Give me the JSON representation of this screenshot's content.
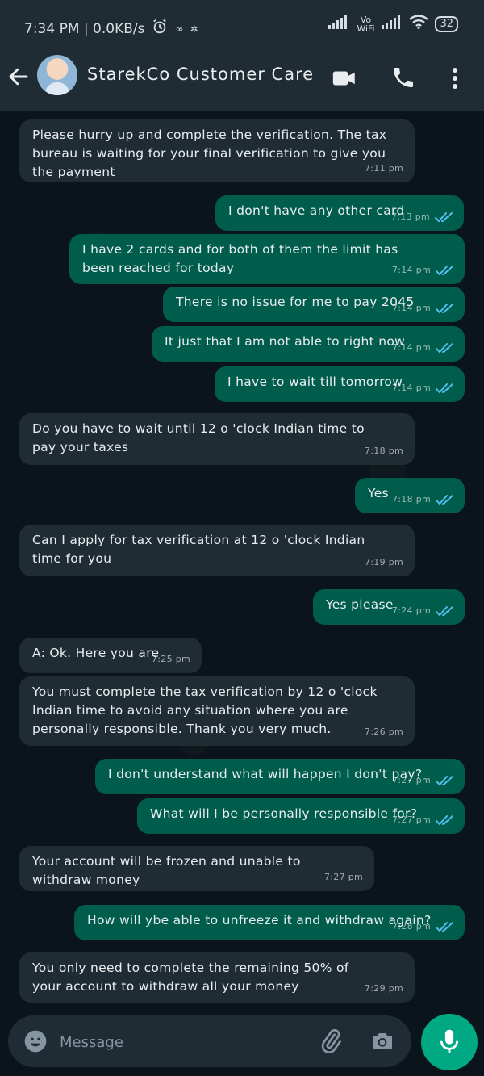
{
  "status_bar": {
    "left_text": "7:34 PM | 0.0KB/s",
    "battery": "32",
    "vo_wifi": "Vo WiFi"
  },
  "header": {
    "title": "StarekCo Customer Care"
  },
  "messages": [
    {
      "dir": "in",
      "text": "Please hurry up and complete the verification. The tax bureau is waiting for your final verification to give you the payment",
      "time": "7:11 pm"
    },
    {
      "dir": "out",
      "text": "I don't have any other card",
      "time": "7:13 pm"
    },
    {
      "dir": "out",
      "text": "I have 2 cards and for both of them the limit has been reached for today",
      "time": "7:14 pm"
    },
    {
      "dir": "out",
      "text": "There is no issue for me to pay 2045",
      "time": "7:14 pm"
    },
    {
      "dir": "out",
      "text": "It just that I am not able to right now",
      "time": "7:14 pm"
    },
    {
      "dir": "out",
      "text": "I have to wait till tomorrow",
      "time": "7:14 pm"
    },
    {
      "dir": "in",
      "text": "Do you have to wait until 12 o 'clock Indian time to pay your taxes",
      "time": "7:18 pm"
    },
    {
      "dir": "out",
      "text": "Yes",
      "time": "7:18 pm"
    },
    {
      "dir": "in",
      "text": "Can I apply for tax verification at 12 o 'clock Indian time for you",
      "time": "7:19 pm"
    },
    {
      "dir": "out",
      "text": "Yes please",
      "time": "7:24 pm"
    },
    {
      "dir": "in",
      "text": "A: Ok. Here you are",
      "time": "7:25 pm"
    },
    {
      "dir": "in",
      "text": "You must complete the tax verification by 12 o 'clock Indian time to avoid any situation where you are personally responsible. Thank you very much.",
      "time": "7:26 pm"
    },
    {
      "dir": "out",
      "text": "I don't understand what will happen I don't pay?",
      "time": "7:27 pm"
    },
    {
      "dir": "out",
      "text": "What will I be personally responsible for?",
      "time": "7:27 pm"
    },
    {
      "dir": "in",
      "text": "Your account will be frozen and unable to withdraw money",
      "time": "7:27 pm"
    },
    {
      "dir": "out",
      "text": "How will ybe able to unfreeze it and withdraw again?",
      "time": "7:28 pm"
    },
    {
      "dir": "in",
      "text": "You only need to complete the remaining 50% of your account to withdraw all your money",
      "time": "7:29 pm"
    }
  ],
  "composer": {
    "placeholder": "Message"
  },
  "colors": {
    "incoming_bubble": "#1f2c34",
    "outgoing_bubble": "#005c4b",
    "accent": "#00a884",
    "read_ticks": "#53bdeb"
  }
}
